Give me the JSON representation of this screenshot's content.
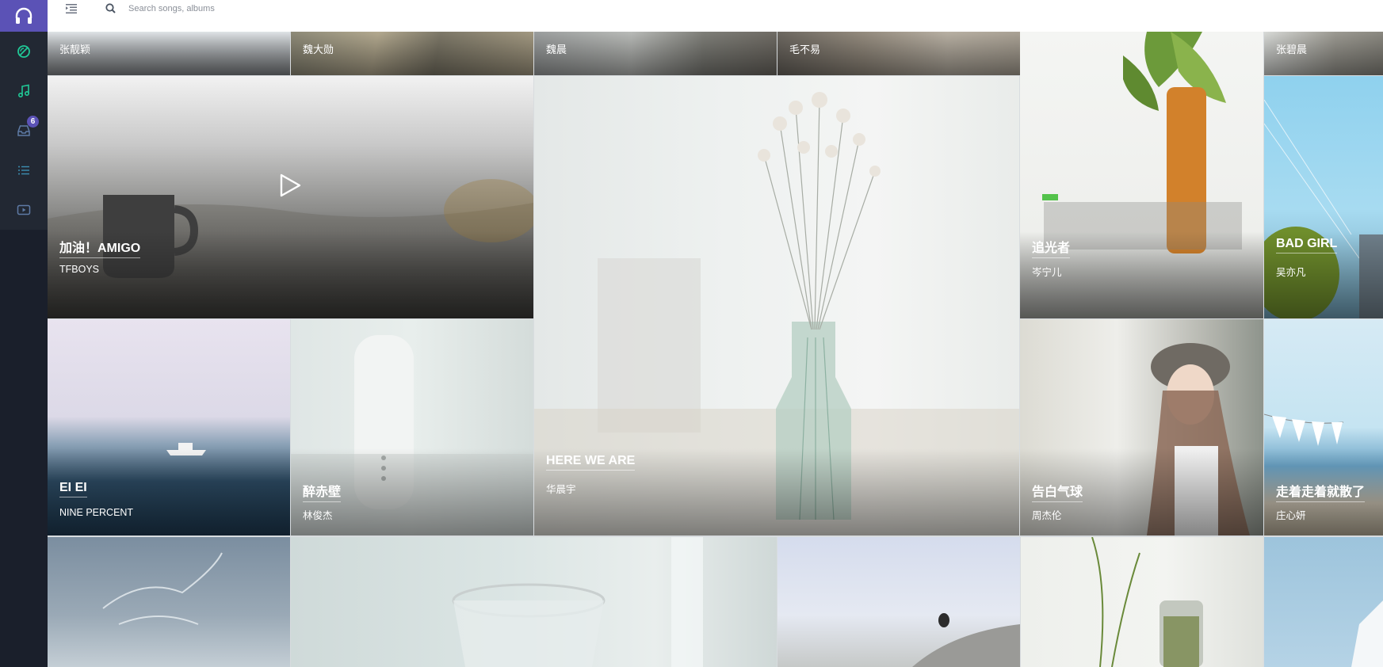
{
  "sidebar": {
    "icons": [
      {
        "name": "headphones-icon"
      },
      {
        "name": "discover-icon"
      },
      {
        "name": "music-note-icon"
      },
      {
        "name": "inbox-icon",
        "badge": "6"
      },
      {
        "name": "list-icon"
      },
      {
        "name": "video-icon"
      }
    ],
    "colors": {
      "brand": "#5b52b6",
      "accent": "#20c997",
      "bg": "#1a1f2b"
    }
  },
  "topbar": {
    "search_placeholder": "Search songs, albums"
  },
  "artists_row": [
    "张靓颖",
    "魏大勋",
    "魏晨",
    "毛不易",
    "张碧晨"
  ],
  "featured": [
    {
      "title": "加油！AMIGO",
      "artist": "TFBOYS",
      "playing_control": "play-icon"
    },
    {
      "title": "HERE WE ARE",
      "artist": "华晨宇"
    },
    {
      "title": "追光者",
      "artist": "岑宁儿"
    },
    {
      "title": "BAD GIRL",
      "artist": "吴亦凡"
    },
    {
      "title": "EI EI",
      "artist": "NINE PERCENT"
    },
    {
      "title": "醉赤壁",
      "artist": "林俊杰"
    },
    {
      "title": "告白气球",
      "artist": "周杰伦"
    },
    {
      "title": "走着走着就散了",
      "artist": "庄心妍"
    }
  ]
}
